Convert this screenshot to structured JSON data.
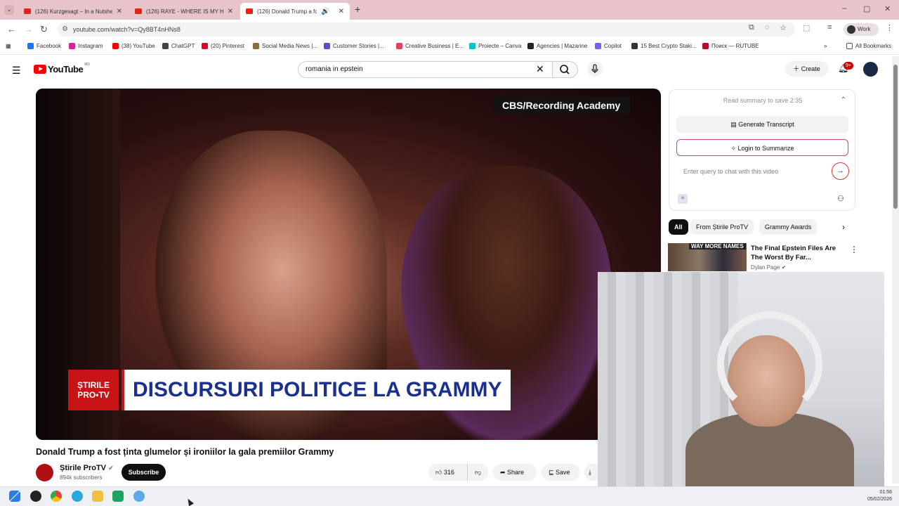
{
  "browser": {
    "tabs": [
      {
        "title": "(126) Kurzgesagt – In a Nutshe"
      },
      {
        "title": "(126) RAYE - WHERE IS MY HUS"
      },
      {
        "title": "(126) Donald Trump a fost ț"
      }
    ],
    "url": "youtube.com/watch?v=Qy8BT4nHNs8",
    "profile": "Work",
    "bookmarks": [
      {
        "label": "Facebook",
        "color": "#1877f2"
      },
      {
        "label": "Instagram",
        "color": "#d6249f"
      },
      {
        "label": "(38) YouTube",
        "color": "#ff0000"
      },
      {
        "label": "ChatGPT",
        "color": "#444444"
      },
      {
        "label": "(20) Pinterest",
        "color": "#e60023"
      },
      {
        "label": "Social Media News |...",
        "color": "#8a6d3b"
      },
      {
        "label": "Customer Stories |...",
        "color": "#5b4bd6"
      },
      {
        "label": "Creative Business | E...",
        "color": "#e4405f"
      },
      {
        "label": "Proiecte – Canva",
        "color": "#00c4cc"
      },
      {
        "label": "Agencies | Mazarine",
        "color": "#222222"
      },
      {
        "label": "Copilot",
        "color": "#7c5cff"
      },
      {
        "label": "15 Best Crypto Staki...",
        "color": "#333333"
      },
      {
        "label": "Поиск — RUTUBE",
        "color": "#b30f1f"
      }
    ],
    "all_bookmarks": "All Bookmarks"
  },
  "youtube": {
    "logo": "YouTube",
    "country_code": "MD",
    "search_value": "romania in epstein",
    "create_label": "Create",
    "notification_count": "9+"
  },
  "video": {
    "credit": "CBS/Recording Academy",
    "lower_third_logo_line1": "ȘTIRILE",
    "lower_third_logo_line2": "PRO•TV",
    "lower_third_text": "DISCURSURI POLITICE LA GRAMMY",
    "title": "Donald Trump a fost ținta glumelor și ironiilor la gala premiilor Grammy",
    "channel_name": "Știrile ProTV",
    "subscribers": "894k subscribers",
    "subscribe_label": "Subscribe",
    "likes": "316",
    "share_label": "Share",
    "save_label": "Save"
  },
  "summary_panel": {
    "read_summary": "Read summary to save 2:35",
    "generate_transcript": "Generate Transcript",
    "login_summarize": "Login to Summarize",
    "query_placeholder": "Enter query to chat with this video"
  },
  "chips": [
    "All",
    "From Știrile ProTV",
    "Grammy Awards"
  ],
  "recommendation": {
    "thumb_text": "WAY MORE NAMES",
    "title": "The Final Epstein Files Are The Worst By Far...",
    "channel": "Dylan Page"
  },
  "taskbar": {
    "time": "01:56",
    "date": "05/02/2026"
  }
}
